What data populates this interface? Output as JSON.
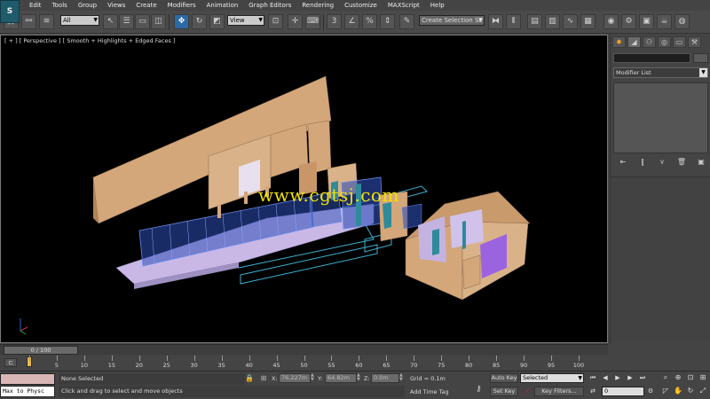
{
  "app": {
    "logo_letter": "S"
  },
  "menu": {
    "items": [
      "Edit",
      "Tools",
      "Group",
      "Views",
      "Create",
      "Modifiers",
      "Animation",
      "Graph Editors",
      "Rendering",
      "Customize",
      "MAXScript",
      "Help"
    ]
  },
  "toolbar": {
    "selection_filter": "All",
    "reference_coord": "View",
    "snap_label": "3",
    "named_selection_placeholder": "Create Selection Se"
  },
  "viewport": {
    "label": "[ + ] [ Perspective ] [ Smooth + Highlights + Edged Faces ]",
    "watermark": "www.cgtsj.com",
    "colors": {
      "background": "#000000",
      "wall": "#d4a77a",
      "glass": "#3a62c9",
      "floor": "#c9b8e6",
      "purple_wall": "#9b63e0",
      "wire": "#3fb0d0"
    }
  },
  "command_panel": {
    "modifier_list": "Modifier List"
  },
  "timeline": {
    "slider": "0 / 100",
    "ticks": [
      0,
      5,
      10,
      15,
      20,
      25,
      30,
      35,
      40,
      45,
      50,
      55,
      60,
      65,
      70,
      75,
      80,
      85,
      90,
      95,
      100
    ]
  },
  "status": {
    "maxscript_listener": "Max to Physc",
    "selection": "None Selected",
    "prompt": "Click and drag to select and move objects",
    "x_label": "X:",
    "x_value": "76.227m",
    "y_label": "Y:",
    "y_value": "64.82m",
    "z_label": "Z:",
    "z_value": "0.0m",
    "grid": "Grid = 0.1m",
    "add_time_tag": "Add Time Tag",
    "auto_key": "Auto Key",
    "selected_dropdown": "Selected",
    "set_key": "Set Key",
    "key_filters": "Key Filters...",
    "current_frame": "0"
  }
}
